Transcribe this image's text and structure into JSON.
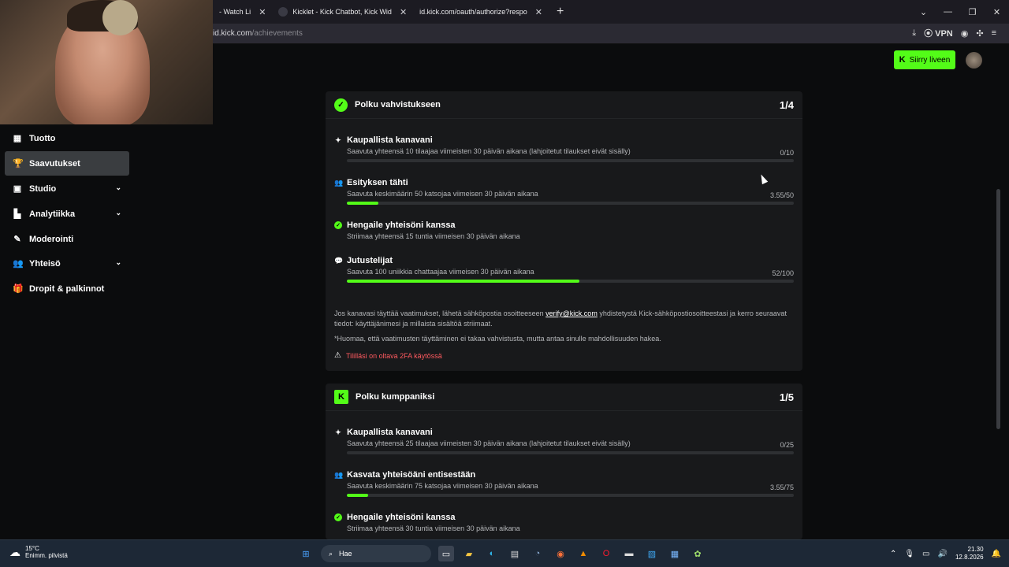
{
  "browser": {
    "tabs": [
      {
        "label": "- Watch Li",
        "close": "✕"
      },
      {
        "label": "Kicklet - Kick Chatbot, Kick Wid",
        "close": "✕"
      },
      {
        "label": "id.kick.com/oauth/authorize?respo",
        "close": "✕"
      }
    ],
    "new_tab": "+",
    "url_host": "id.kick.com",
    "url_path": "/achievements",
    "vpn_label": "VPN",
    "window_controls": [
      "⌄",
      "—",
      "❐",
      "✕"
    ]
  },
  "header": {
    "live_button_icon": "K",
    "live_button_label": "Siirry liveen",
    "avatar_icon": "avatar"
  },
  "sidebar": {
    "items": [
      {
        "label": "Tuotto",
        "icon": "▦",
        "active": false,
        "has_chevron": false
      },
      {
        "label": "Saavutukset",
        "icon": "🏆",
        "active": true,
        "has_chevron": false
      },
      {
        "label": "Studio",
        "icon": "▣",
        "active": false,
        "has_chevron": true
      },
      {
        "label": "Analytiikka",
        "icon": "▙",
        "active": false,
        "has_chevron": true
      },
      {
        "label": "Moderointi",
        "icon": "✎",
        "active": false,
        "has_chevron": false
      },
      {
        "label": "Yhteisö",
        "icon": "👥",
        "active": false,
        "has_chevron": true
      },
      {
        "label": "Dropit & palkinnot",
        "icon": "🎁",
        "active": false,
        "has_chevron": false
      }
    ],
    "chevron": "⌄"
  },
  "verification": {
    "title": "Polku vahvistukseen",
    "count": "1/4",
    "requirements": [
      {
        "title": "Kaupallista kanavani",
        "desc": "Saavuta yhteensä 10 tilaajaa viimeisten 30 päivän aikana (lahjoitetut tilaukset eivät sisälly)",
        "value": "0/10",
        "progress": 0,
        "done": false,
        "icon": "✦"
      },
      {
        "title": "Esityksen tähti",
        "desc": "Saavuta keskimäärin 50 katsojaa viimeisen 30 päivän aikana",
        "value": "3.55/50",
        "progress": 0.071,
        "done": false,
        "icon": "👥"
      },
      {
        "title": "Hengaile yhteisöni kanssa",
        "desc": "Striimaa yhteensä 15 tuntia viimeisen 30 päivän aikana",
        "value": "",
        "progress": null,
        "done": true,
        "icon": "✓"
      },
      {
        "title": "Jutustelijat",
        "desc": "Saavuta 100 uniikkia chattaajaa viimeisen 30 päivän aikana",
        "value": "52/100",
        "progress": 0.52,
        "done": false,
        "icon": "💬"
      }
    ],
    "note_before_link": "Jos kanavasi täyttää vaatimukset, lähetä sähköpostia osoitteeseen ",
    "note_link": "verify@kick.com",
    "note_after_link": " yhdistetystä Kick-sähköpostiosoitteestasi ja kerro seuraavat tiedot: käyttäjänimesi ja millaista sisältöä striimaat.",
    "note2": "*Huomaa, että vaatimusten täyttäminen ei takaa vahvistusta, mutta antaa sinulle mahdollisuuden hakea.",
    "warning": "Tililläsi on oltava 2FA käytössä"
  },
  "partner": {
    "title": "Polku kumppaniksi",
    "count": "1/5",
    "requirements": [
      {
        "title": "Kaupallista kanavani",
        "desc": "Saavuta yhteensä 25 tilaajaa viimeisten 30 päivän aikana (lahjoitetut tilaukset eivät sisälly)",
        "value": "0/25",
        "progress": 0,
        "done": false,
        "icon": "✦"
      },
      {
        "title": "Kasvata yhteisöäni entisestään",
        "desc": "Saavuta keskimäärin 75 katsojaa viimeisen 30 päivän aikana",
        "value": "3.55/75",
        "progress": 0.047,
        "done": false,
        "icon": "👥"
      },
      {
        "title": "Hengaile yhteisöni kanssa",
        "desc": "Striimaa yhteensä 30 tuntia viimeisen 30 päivän aikana",
        "value": "",
        "progress": null,
        "done": true,
        "icon": "✓"
      }
    ]
  },
  "taskbar": {
    "temp": "15°C",
    "weather": "Enimm. pilvistä",
    "search_label": "Hae",
    "time": "21.30",
    "date": "12.8.2026"
  }
}
